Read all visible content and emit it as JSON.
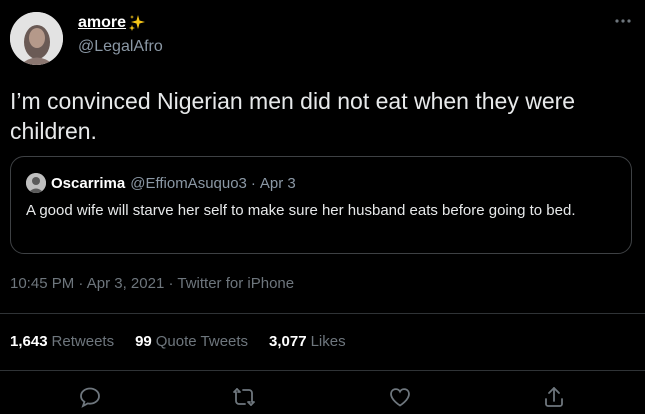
{
  "tweet": {
    "display_name": "amore",
    "handle": "@LegalAfro",
    "text": "I’m convinced Nigerian men did not eat when they were children.",
    "time": "10:45 PM",
    "date": "Apr 3, 2021",
    "source": "Twitter for iPhone",
    "separator": "·"
  },
  "quote": {
    "name": "Oscarrima",
    "handle": "@EffiomAsuquo3",
    "separator": "·",
    "date": "Apr 3",
    "text": "A good wife will starve her self to make sure her husband eats before going to bed."
  },
  "stats": {
    "retweets_count": "1,643",
    "retweets_label": "Retweets",
    "quote_count": "99",
    "quote_label": "Quote Tweets",
    "likes_count": "3,077",
    "likes_label": "Likes"
  },
  "icons": {
    "more": "more-horizontal-icon",
    "reply": "reply-icon",
    "retweet": "retweet-icon",
    "like": "heart-icon",
    "share": "share-icon",
    "sparkle": "sparkles-icon"
  },
  "colors": {
    "background": "#000000",
    "primary_text": "#e7e9ea",
    "secondary_text": "#6e767d",
    "border": "#2f3336",
    "sparkle": "#f5c518"
  }
}
